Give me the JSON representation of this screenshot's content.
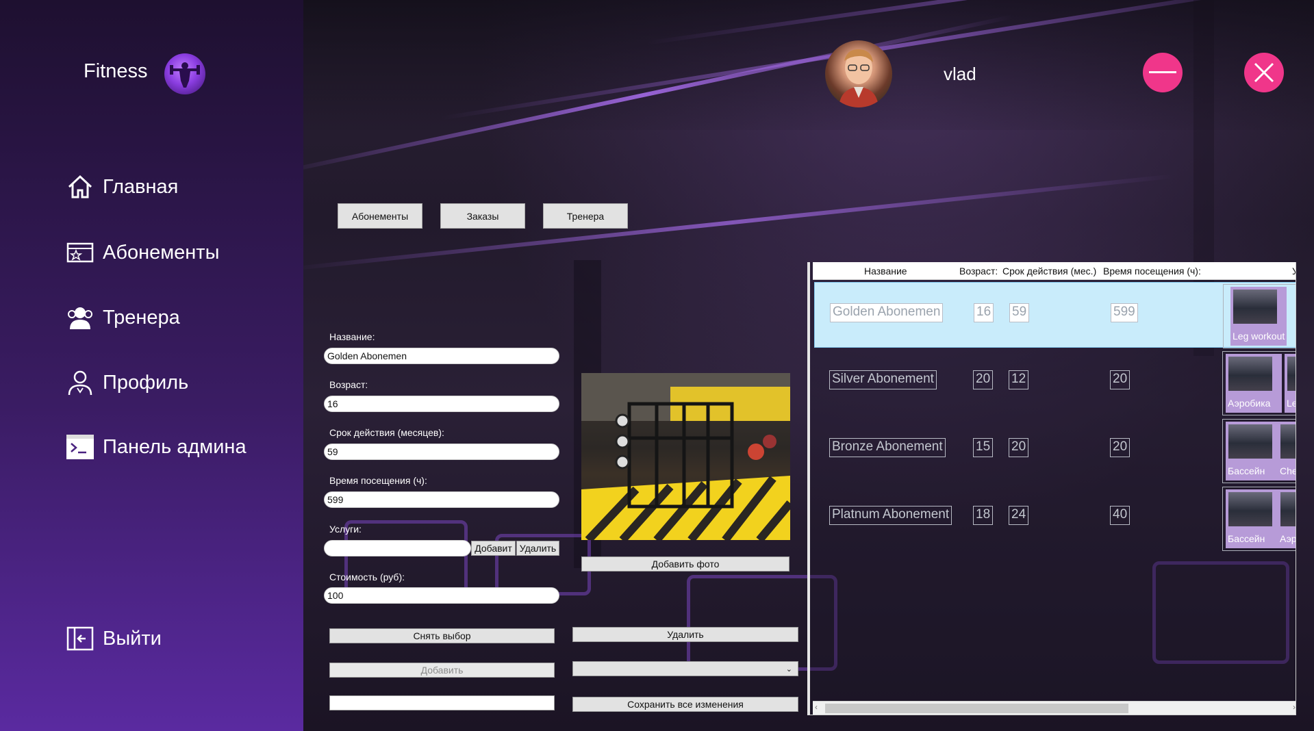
{
  "app": {
    "title": "Fitness",
    "user": "vlad"
  },
  "nav": [
    {
      "label": "Главная",
      "icon": "home-icon"
    },
    {
      "label": "Абонементы",
      "icon": "ticket-icon"
    },
    {
      "label": "Тренера",
      "icon": "trainers-icon"
    },
    {
      "label": "Профиль",
      "icon": "profile-icon"
    },
    {
      "label": "Панель админа",
      "icon": "terminal-icon"
    }
  ],
  "logout": {
    "label": "Выйти",
    "icon": "logout-icon"
  },
  "tabs": [
    "Абонементы",
    "Заказы",
    "Тренера"
  ],
  "form": {
    "name_label": "Название:",
    "name_value": "Golden Abonemen",
    "age_label": "Возраст:",
    "age_value": "16",
    "duration_label": "Срок действия (месяцев):",
    "duration_value": "59",
    "visit_label": "Время посещения (ч):",
    "visit_value": "599",
    "services_label": "Услуги:",
    "services_value": "",
    "services_add": "Добавит",
    "services_remove": "Удалить",
    "price_label": "Стоимость (руб):",
    "price_value": "100",
    "deselect": "Снять выбор",
    "add": "Добавить",
    "extra_value": ""
  },
  "photo": {
    "add_label": "Добавить фото"
  },
  "actions": {
    "delete": "Удалить",
    "dropdown_value": "",
    "save_all": "Сохранить все изменения"
  },
  "grid": {
    "columns": [
      "Название",
      "Возраст:",
      "Срок действия (мес.)",
      "Время посещения (ч):",
      "Ус"
    ],
    "rows": [
      {
        "name": "Golden Abonemen",
        "age": "16",
        "duration": "59",
        "hours": "599",
        "services": [
          "Leg workout"
        ]
      },
      {
        "name": "Silver Abonement",
        "age": "20",
        "duration": "12",
        "hours": "20",
        "services": [
          "Аэробика",
          "Leg"
        ]
      },
      {
        "name": "Bronze Abonement",
        "age": "15",
        "duration": "20",
        "hours": "20",
        "services": [
          "Бассейн",
          "Ches"
        ]
      },
      {
        "name": "Platnum Abonement",
        "age": "18",
        "duration": "24",
        "hours": "40",
        "services": [
          "Бассейн",
          "Аэро"
        ]
      }
    ]
  },
  "colors": {
    "accent": "#f0368a",
    "sidebar_top": "#1e1030",
    "sidebar_bottom": "#5a2aa0",
    "selected_row": "#c9ecfb"
  }
}
